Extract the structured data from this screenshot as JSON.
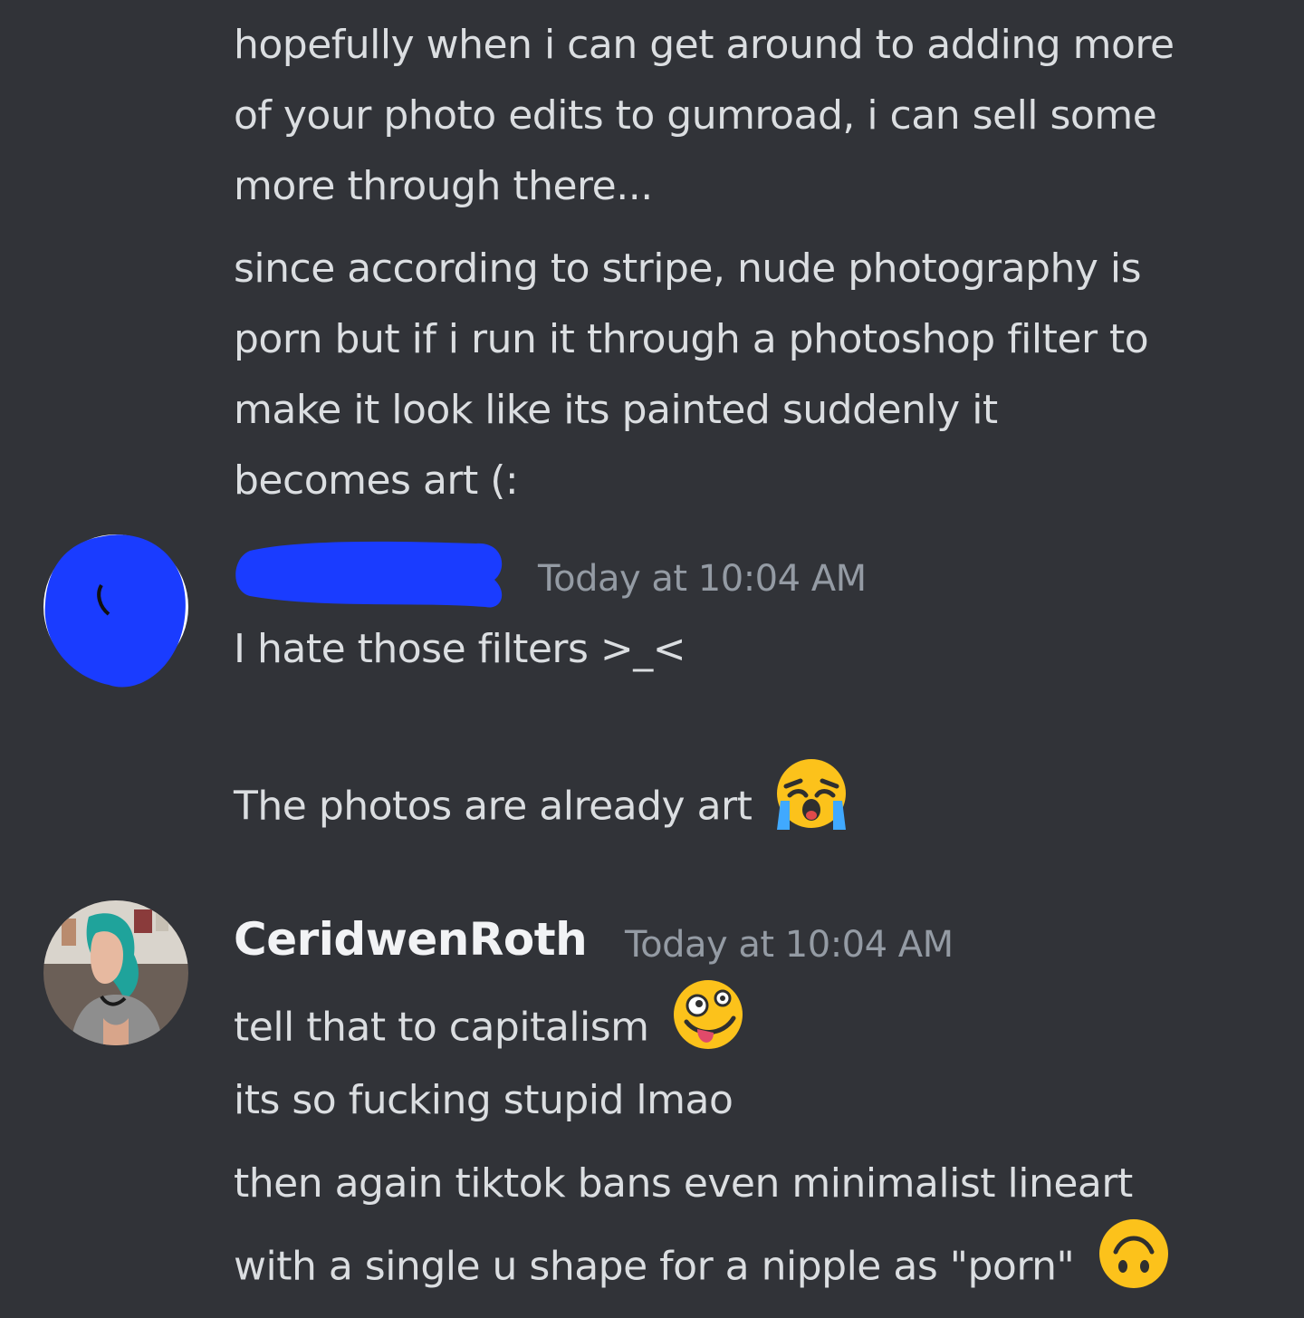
{
  "messages": {
    "group1": {
      "lines": [
        "hopefully when i can get around to adding more",
        "of your photo edits to gumroad, i can sell some",
        "more through there...",
        "since according to stripe, nude photography is",
        "porn but if i run it through a photoshop filter to",
        "make it look like its painted suddenly it",
        "becomes art (:"
      ]
    },
    "group2": {
      "username": "",
      "timestamp": "Today at 10:04 AM",
      "line1": "I hate those filters >_<",
      "line2": "The photos are already art",
      "line2_emoji": "loudly-crying-face-emoji"
    },
    "group3": {
      "username": "CeridwenRoth",
      "timestamp": "Today at 10:04 AM",
      "line1": "tell that to capitalism",
      "line1_emoji": "zany-face-emoji",
      "line2": "its so fucking stupid lmao",
      "line3": "then again tiktok bans even minimalist lineart",
      "line4": "with a single u shape for a nipple as \"porn\"",
      "line4_emoji": "upside-down-face-emoji"
    }
  },
  "colors": {
    "background": "#313338",
    "text": "#dbdee1",
    "timestamp": "#949ba4",
    "username": "#f2f3f5",
    "redaction": "#1a3cff"
  }
}
